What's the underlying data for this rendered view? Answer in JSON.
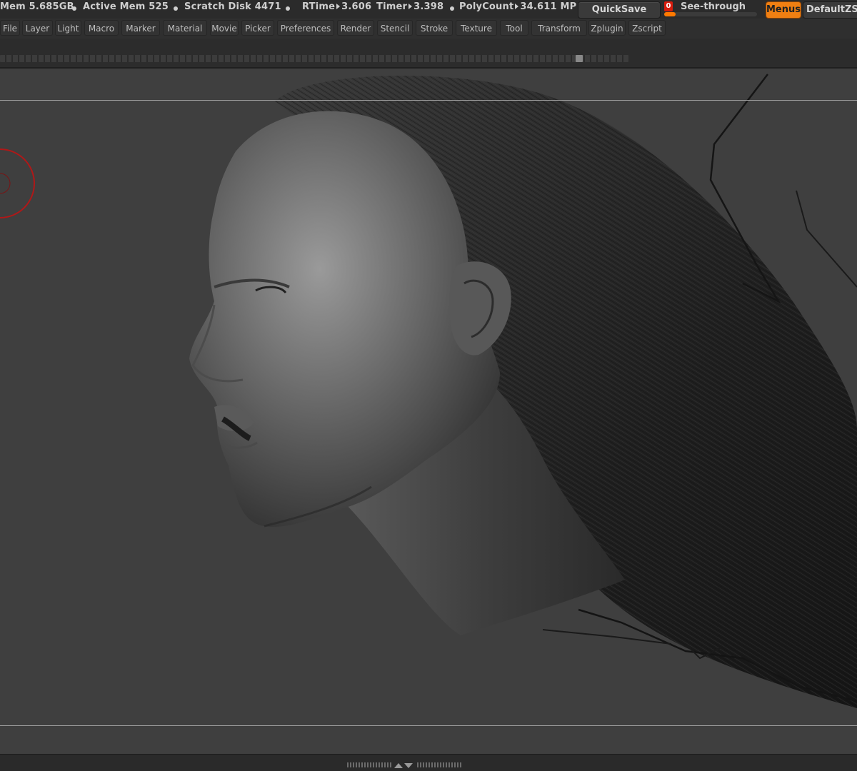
{
  "status": {
    "mem": "Mem 5.685GB",
    "active_mem": "Active Mem 525",
    "scratch_disk": "Scratch Disk 4471",
    "rtime_label": "RTime",
    "rtime_value": "3.606",
    "timer_label": "Timer",
    "timer_value": "3.398",
    "polycount_label": "PolyCount",
    "polycount_value": "34.611 MP"
  },
  "toolbar": {
    "quicksave_label": "QuickSave",
    "seethrough_value": "0",
    "seethrough_label": "See-through",
    "menus_label": "Menus",
    "default_label": "DefaultZS"
  },
  "menu": {
    "items": [
      "File",
      "Layer",
      "Light",
      "Macro",
      "Marker",
      "Material",
      "Movie",
      "Picker",
      "Preferences",
      "Render",
      "Stencil",
      "Stroke",
      "Texture",
      "Tool",
      "Transform",
      "Zplugin",
      "Zscript"
    ]
  },
  "colors": {
    "accent": "#f07f12",
    "brush_ring": "#b01818",
    "canvas_bg": "#3f3f3f"
  }
}
